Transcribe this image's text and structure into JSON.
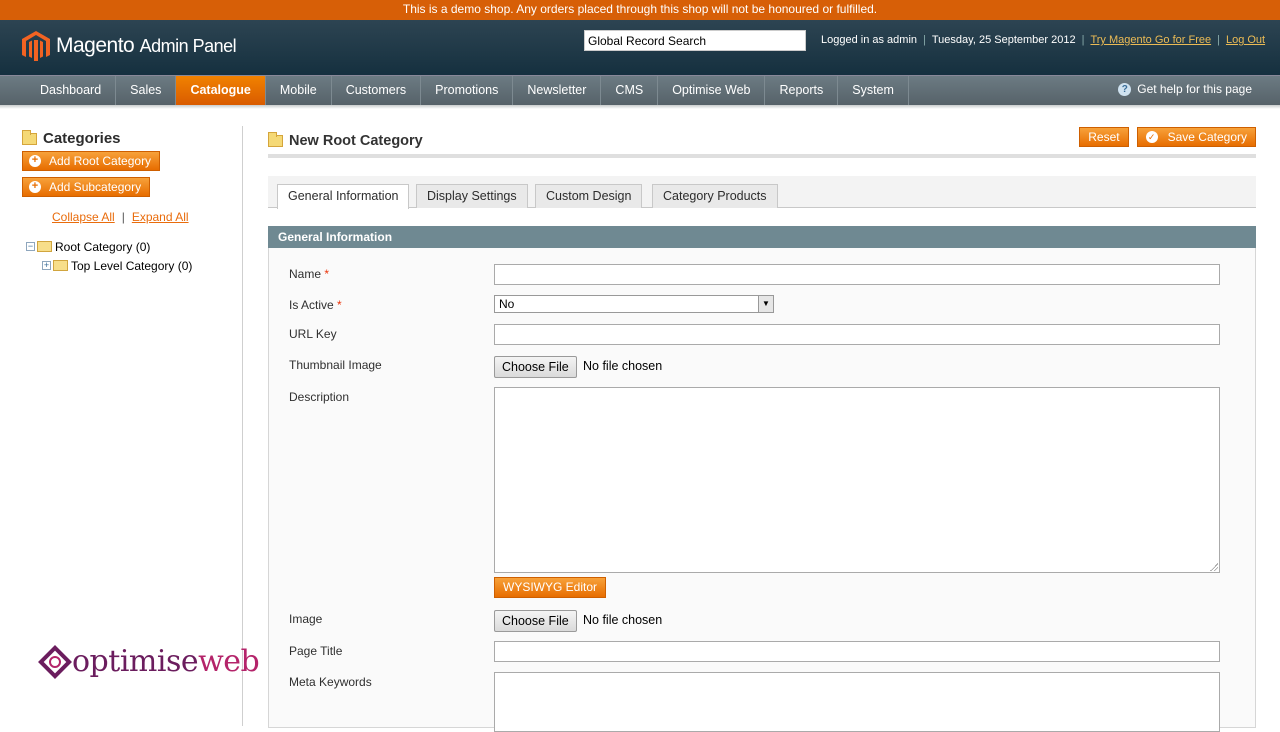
{
  "demo_notice": "This is a demo shop. Any orders placed through this shop will not be honoured or fulfilled.",
  "header": {
    "logo_main": "Magento",
    "logo_sub": "Admin Panel",
    "search_value": "Global Record Search",
    "logged_in": "Logged in as admin",
    "date": "Tuesday, 25 September 2012",
    "try_link": "Try Magento Go for Free",
    "logout_link": "Log Out"
  },
  "nav": {
    "items": [
      "Dashboard",
      "Sales",
      "Catalogue",
      "Mobile",
      "Customers",
      "Promotions",
      "Newsletter",
      "CMS",
      "Optimise Web",
      "Reports",
      "System"
    ],
    "active": "Catalogue",
    "help": "Get help for this page"
  },
  "sidebar": {
    "title": "Categories",
    "add_root": "Add Root Category",
    "add_sub": "Add Subcategory",
    "collapse_all": "Collapse All",
    "pipe": "|",
    "expand_all": "Expand All",
    "tree": [
      {
        "label": "Root Category (0)",
        "toggle": "−"
      },
      {
        "label": "Top Level Category (0)",
        "toggle": "+"
      }
    ]
  },
  "main": {
    "title": "New Root Category",
    "reset": "Reset",
    "save": "Save Category",
    "tabs": [
      "General Information",
      "Display Settings",
      "Custom Design",
      "Category Products"
    ],
    "section_title": "General Information",
    "fields": {
      "name": "Name",
      "is_active": "Is Active",
      "is_active_value": "No",
      "url_key": "URL Key",
      "thumbnail": "Thumbnail Image",
      "description": "Description",
      "wysiwyg": "WYSIWYG Editor",
      "image": "Image",
      "page_title": "Page Title",
      "meta_keywords": "Meta Keywords",
      "choose_file": "Choose File",
      "no_file": "No file chosen",
      "required_mark": "*"
    }
  },
  "watermark": {
    "text_a": "optimise",
    "text_b": "web"
  },
  "colors": {
    "accent": "#e76d00",
    "header": "#15303f",
    "section": "#6f8992",
    "watermark": "#6b1d5e"
  }
}
